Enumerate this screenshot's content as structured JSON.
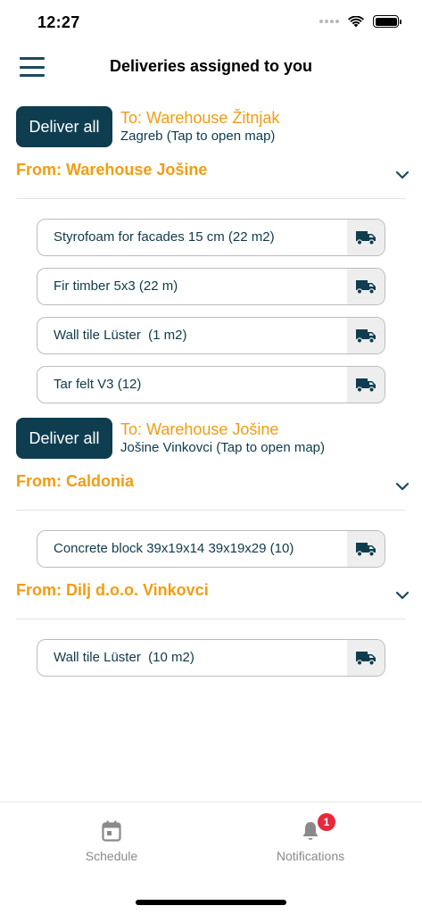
{
  "status_bar": {
    "time": "12:27"
  },
  "header": {
    "title": "Deliveries assigned to you"
  },
  "deliveries": [
    {
      "deliver_all_label": "Deliver all",
      "to": "To: Warehouse Žitnjak",
      "location": "Zagreb (Tap to open map)",
      "sources": [
        {
          "from": "From: Warehouse Jošine",
          "items": [
            "Styrofoam for facades 15 cm (22 m2)",
            "Fir timber 5x3 (22 m)",
            "Wall tile Lüster  (1 m2)",
            "Tar felt V3 (12)"
          ]
        }
      ]
    },
    {
      "deliver_all_label": "Deliver all",
      "to": "To: Warehouse Jošine",
      "location": "Jošine Vinkovci (Tap to open map)",
      "sources": [
        {
          "from": "From: Caldonia",
          "items": [
            "Concrete block 39x19x14 39x19x29 (10)"
          ]
        },
        {
          "from": "From: Dilj d.o.o. Vinkovci",
          "items": [
            "Wall tile Lüster  (10 m2)"
          ]
        }
      ]
    }
  ],
  "tab_bar": {
    "schedule_label": "Schedule",
    "notifications_label": "Notifications",
    "notifications_badge": "1"
  },
  "icons": {
    "menu": "hamburger-icon",
    "truck": "truck-icon",
    "chevron": "chevron-down-icon",
    "schedule": "calendar-icon",
    "notifications": "bell-icon"
  },
  "colors": {
    "primary": "#0f3d50",
    "accent": "#f39c12",
    "badge": "#e8293b"
  }
}
